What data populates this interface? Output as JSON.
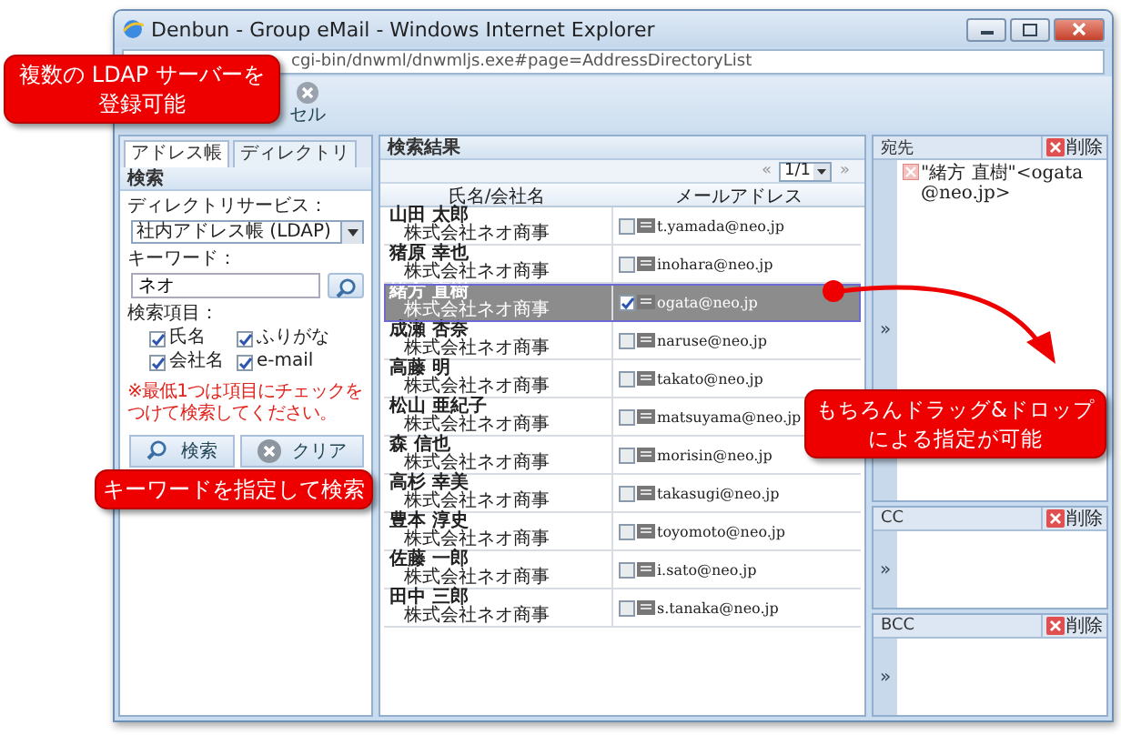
{
  "window": {
    "title": "Denbun - Group eMail - Windows Internet Explorer",
    "address": "cgi-bin/dnwml/dnwmljs.exe#page=AddressDirectoryList"
  },
  "toolbar": {
    "button_label": "セル"
  },
  "left_panel": {
    "tabs": [
      {
        "label": "アドレス帳",
        "selected": true
      },
      {
        "label": "ディレクトリ",
        "selected": false
      }
    ],
    "section_title": "検索",
    "directory_label": "ディレクトリサービス：",
    "directory_value": "社内アドレス帳 (LDAP)",
    "keyword_label": "キーワード：",
    "keyword_value": "ネオ",
    "fields_label": "検索項目：",
    "fields": [
      {
        "label": "氏名",
        "checked": true
      },
      {
        "label": "ふりがな",
        "checked": true
      },
      {
        "label": "会社名",
        "checked": true
      },
      {
        "label": "e-mail",
        "checked": true
      }
    ],
    "note": "※最低1つは項目にチェックをつけて検索してください。",
    "buttons": [
      {
        "label": "検索",
        "kind": "search"
      },
      {
        "label": "クリア",
        "kind": "clear"
      }
    ]
  },
  "results": {
    "title": "検索結果",
    "prev": "«",
    "page": "1/1",
    "next": "»",
    "columns": [
      "氏名/会社名",
      "メールアドレス"
    ],
    "rows": [
      {
        "name": "山田 太郎",
        "company": "株式会社ネオ商事",
        "email": "t.yamada@neo.jp",
        "checked": false,
        "selected": false
      },
      {
        "name": "猪原 幸也",
        "company": "株式会社ネオ商事",
        "email": "inohara@neo.jp",
        "checked": false,
        "selected": false
      },
      {
        "name": "緒方 直樹",
        "company": "株式会社ネオ商事",
        "email": "ogata@neo.jp",
        "checked": true,
        "selected": true
      },
      {
        "name": "成瀬 杏奈",
        "company": "株式会社ネオ商事",
        "email": "naruse@neo.jp",
        "checked": false,
        "selected": false
      },
      {
        "name": "高藤 明",
        "company": "株式会社ネオ商事",
        "email": "takato@neo.jp",
        "checked": false,
        "selected": false
      },
      {
        "name": "松山 亜紀子",
        "company": "株式会社ネオ商事",
        "email": "matsuyama@neo.jp",
        "checked": false,
        "selected": false
      },
      {
        "name": "森 信也",
        "company": "株式会社ネオ商事",
        "email": "morisin@neo.jp",
        "checked": false,
        "selected": false
      },
      {
        "name": "高杉 幸美",
        "company": "株式会社ネオ商事",
        "email": "takasugi@neo.jp",
        "checked": false,
        "selected": false
      },
      {
        "name": "豊本 淳史",
        "company": "株式会社ネオ商事",
        "email": "toyomoto@neo.jp",
        "checked": false,
        "selected": false
      },
      {
        "name": "佐藤 一郎",
        "company": "株式会社ネオ商事",
        "email": "i.sato@neo.jp",
        "checked": false,
        "selected": false
      },
      {
        "name": "田中 三郎",
        "company": "株式会社ネオ商事",
        "email": "s.tanaka@neo.jp",
        "checked": false,
        "selected": false
      }
    ]
  },
  "recipients": [
    {
      "title": "宛先",
      "delete_label": "削除",
      "move_glyph": "»",
      "entries": [
        "\"緒方 直樹\"<ogata@neo.jp>"
      ]
    },
    {
      "title": "CC",
      "delete_label": "削除",
      "move_glyph": "»"
    },
    {
      "title": "BCC",
      "delete_label": "削除",
      "move_glyph": "»"
    }
  ],
  "callouts": [
    {
      "lines": [
        "複数の LDAP サーバーを",
        "登録可能"
      ]
    },
    {
      "lines": [
        "キーワードを指定して検索"
      ]
    },
    {
      "lines": [
        "もちろんドラッグ&ドロップ",
        "による指定が可能"
      ]
    }
  ]
}
